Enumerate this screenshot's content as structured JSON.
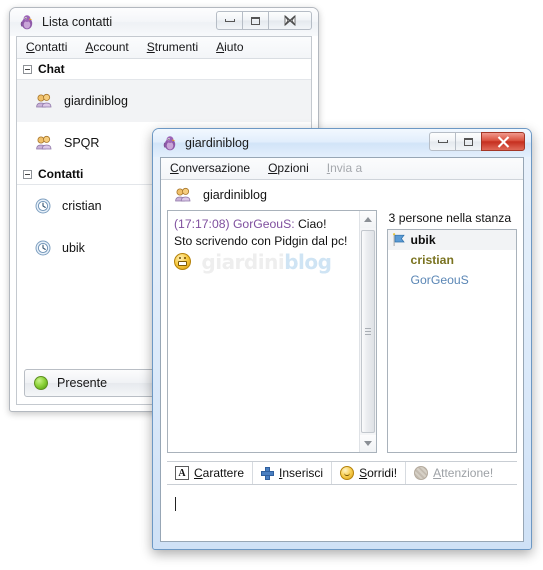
{
  "contact_window": {
    "title": "Lista contatti",
    "icon": "pidgin-bird-icon",
    "buttons": {
      "minimize": "minimize-icon",
      "maximize": "maximize-icon",
      "close": "close-icon"
    },
    "menu": [
      {
        "label": "Contatti",
        "accel": "C"
      },
      {
        "label": "Account",
        "accel": "A"
      },
      {
        "label": "Strumenti",
        "accel": "S"
      },
      {
        "label": "Aiuto",
        "accel": "A"
      }
    ],
    "groups": [
      {
        "label": "Chat",
        "expanded": true,
        "items": [
          {
            "name": "giardiniblog",
            "icon": "chat-group-icon",
            "selected": true
          },
          {
            "name": "SPQR",
            "icon": "chat-group-icon",
            "selected": false
          }
        ]
      },
      {
        "label": "Contatti",
        "expanded": true,
        "items": [
          {
            "name": "cristian",
            "icon": "away-clock-icon",
            "selected": false
          },
          {
            "name": "ubik",
            "icon": "away-clock-icon",
            "selected": false
          }
        ]
      }
    ],
    "status": {
      "label": "Presente",
      "dot_color": "#7ec822"
    }
  },
  "conversation_window": {
    "title": "giardiniblog",
    "icon": "pidgin-bird-icon",
    "buttons": {
      "minimize": "minimize-icon",
      "maximize": "maximize-icon",
      "close": "close-icon"
    },
    "close_color": "#c62f20",
    "menu": [
      {
        "label": "Conversazione",
        "accel": "C",
        "disabled": false
      },
      {
        "label": "Opzioni",
        "accel": "O",
        "disabled": false
      },
      {
        "label": "Invia a",
        "accel": "I",
        "disabled": true
      }
    ],
    "header": {
      "name": "giardiniblog",
      "icon": "chat-group-icon"
    },
    "messages": [
      {
        "time": "(17:17:08)",
        "nick": "GorGeouS:",
        "text": "Ciao!"
      },
      {
        "text": "Sto scrivendo con Pidgin dal pc!"
      }
    ],
    "emoticon": "grin-smiley-icon",
    "watermark": {
      "part1": "giardini",
      "part2": "blog",
      "color1": "#eeeeee",
      "color2": "#cfe4f4"
    },
    "scrollbar": {
      "up": "scroll-up-arrow-icon",
      "down": "scroll-down-arrow-icon"
    },
    "participants": {
      "count_label": "3 persone nella stanza",
      "users": [
        {
          "name": "ubik",
          "style": "bold",
          "badge": "founder-flag-icon",
          "selected": true
        },
        {
          "name": "cristian",
          "style": "olive",
          "badge": null,
          "selected": false
        },
        {
          "name": "GorGeouS",
          "style": "blue",
          "badge": null,
          "selected": false
        }
      ]
    },
    "format_toolbar": [
      {
        "label": "Carattere",
        "accel": "C",
        "icon": "font-letter-icon",
        "disabled": false
      },
      {
        "label": "Inserisci",
        "accel": "I",
        "icon": "plus-insert-icon",
        "disabled": false
      },
      {
        "label": "Sorridi!",
        "accel": "S",
        "icon": "smiley-icon",
        "disabled": false
      },
      {
        "label": "Attenzione!",
        "accel": "A",
        "icon": "attention-buzz-icon",
        "disabled": true
      }
    ],
    "input": {
      "value": "",
      "placeholder": ""
    }
  }
}
